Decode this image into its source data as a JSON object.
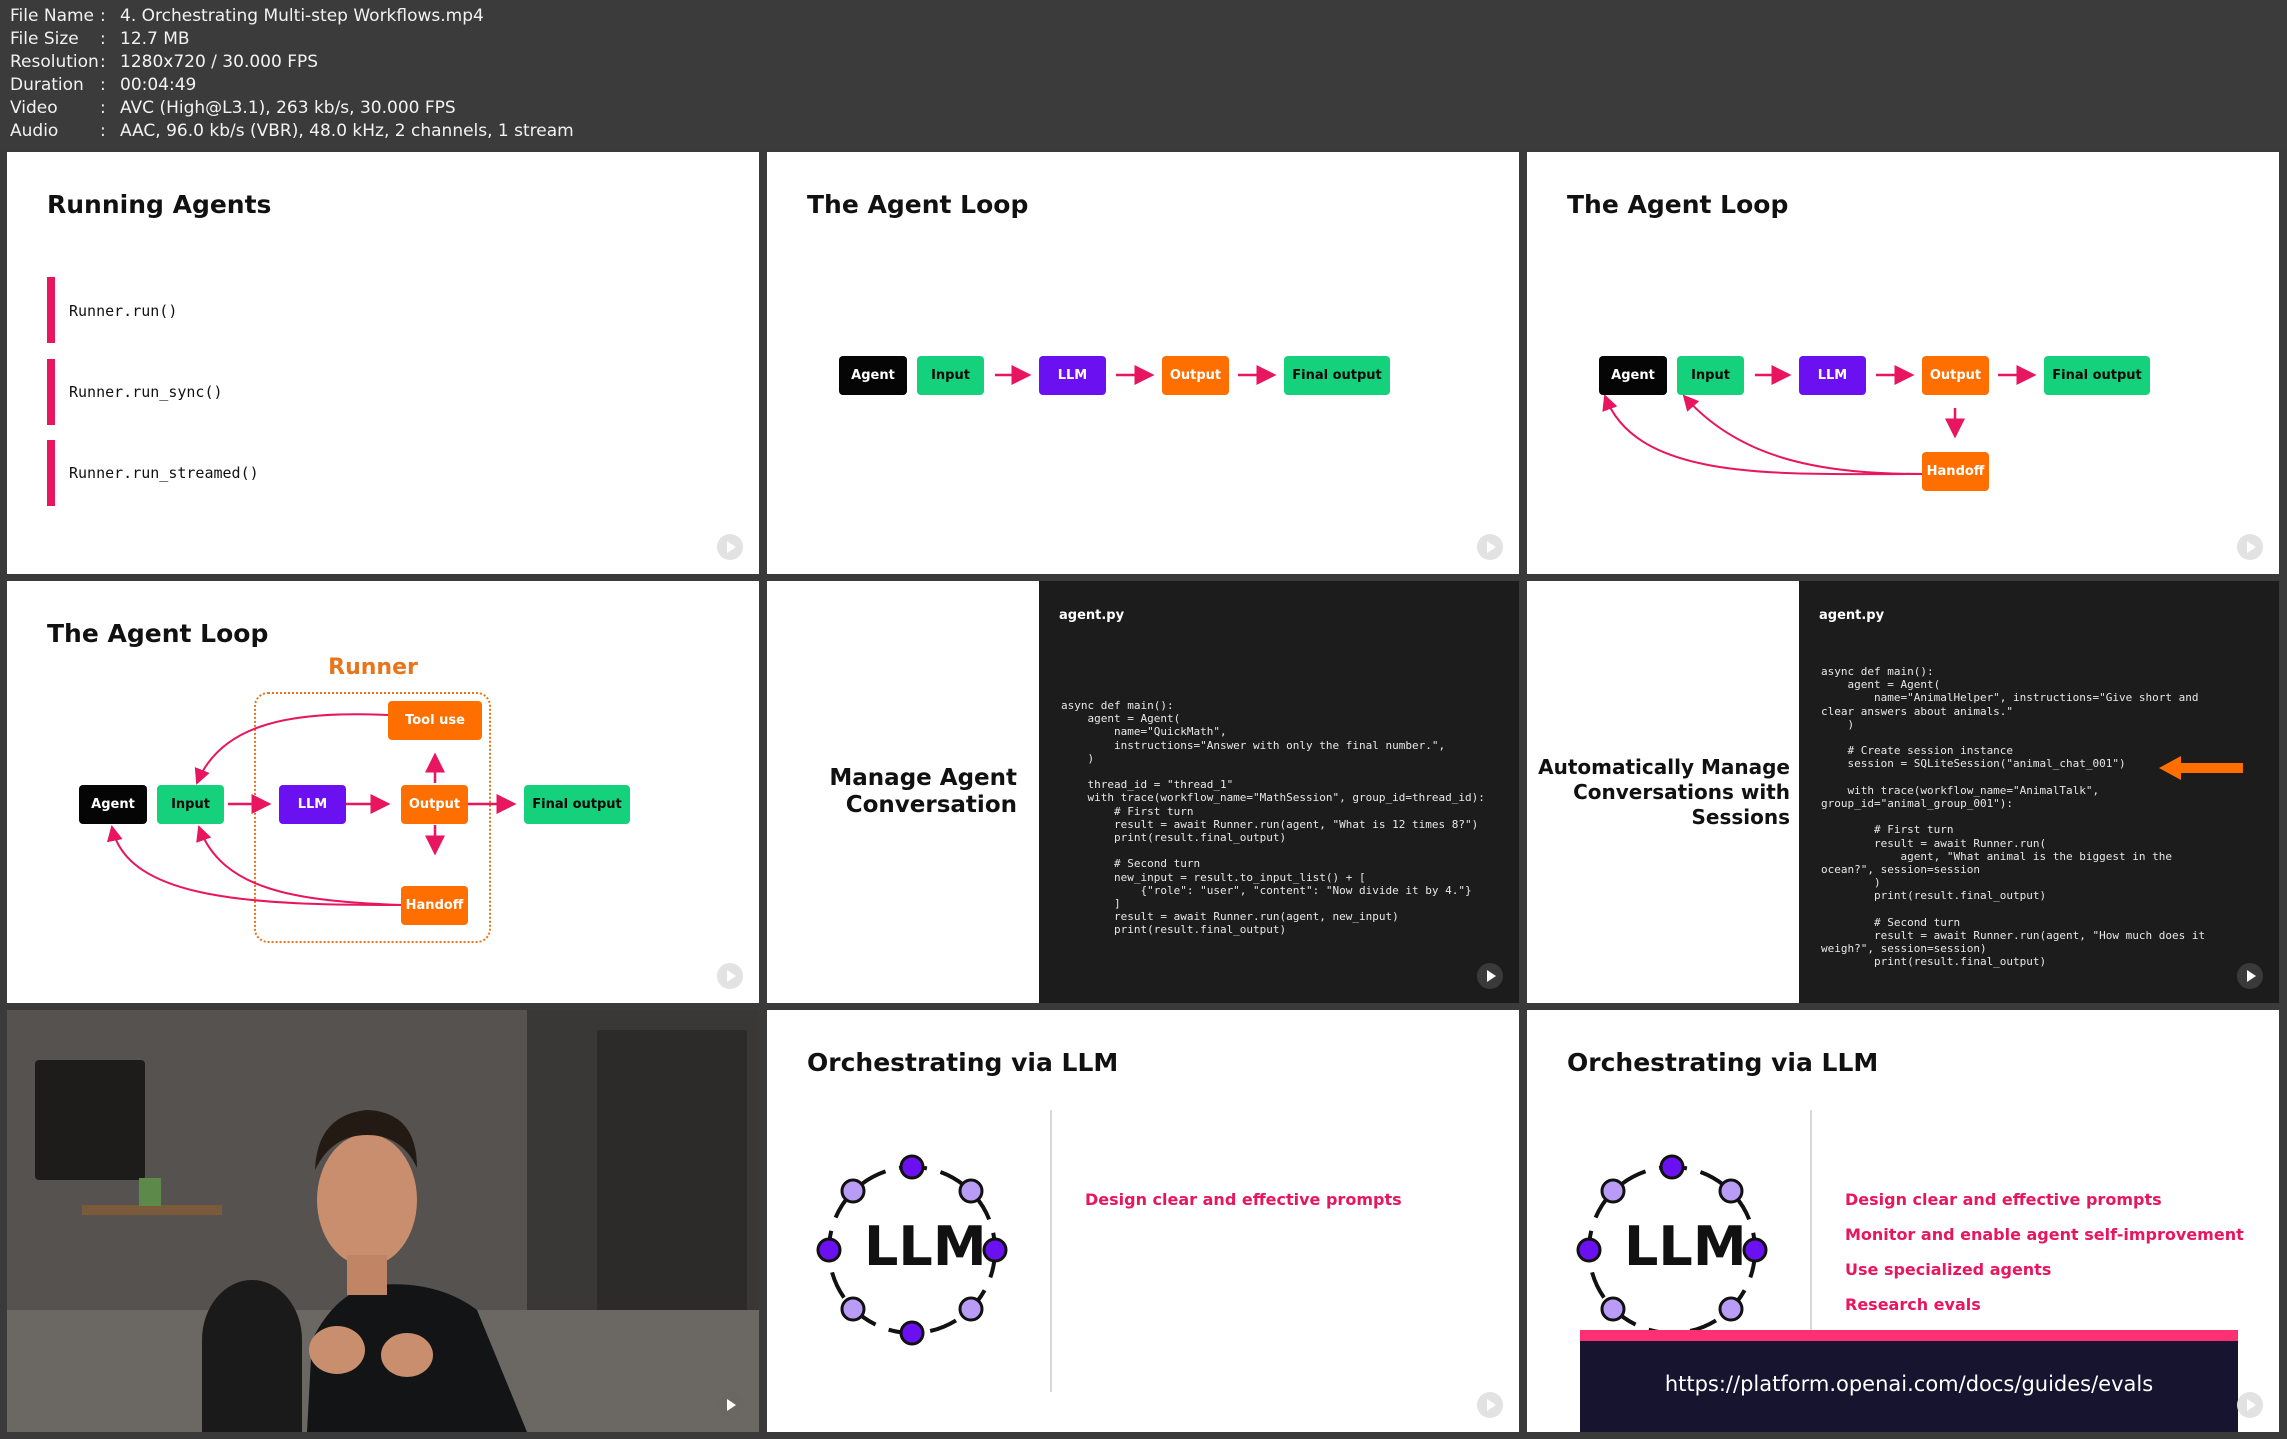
{
  "file_info": [
    {
      "key": "File Name",
      "value": "4. Orchestrating Multi-step Workflows.mp4"
    },
    {
      "key": "File Size",
      "value": "12.7 MB"
    },
    {
      "key": "Resolution",
      "value": "1280x720 / 30.000 FPS"
    },
    {
      "key": "Duration",
      "value": "00:04:49"
    },
    {
      "key": "Video",
      "value": "AVC (High@L3.1), 263 kb/s, 30.000 FPS"
    },
    {
      "key": "Audio",
      "value": "AAC, 96.0 kb/s (VBR), 48.0 kHz, 2 channels, 1 stream"
    }
  ],
  "slide1": {
    "title": "Running Agents",
    "items": [
      "Runner.run()",
      "Runner.run_sync()",
      "Runner.run_streamed()"
    ]
  },
  "labels": {
    "agent": "Agent",
    "input": "Input",
    "llm": "LLM",
    "output": "Output",
    "final_output": "Final output",
    "handoff": "Handoff",
    "tool_use": "Tool use",
    "runner": "Runner"
  },
  "slide2": {
    "title": "The Agent Loop"
  },
  "slide3": {
    "title": "The Agent Loop"
  },
  "slide4": {
    "title": "The Agent Loop"
  },
  "slide5": {
    "heading": "Manage Agent\nConversation",
    "filename": "agent.py",
    "code": "async def main():\n    agent = Agent(\n        name=\"QuickMath\",\n        instructions=\"Answer with only the final number.\",\n    )\n\n    thread_id = \"thread_1\"\n    with trace(workflow_name=\"MathSession\", group_id=thread_id):\n        # First turn\n        result = await Runner.run(agent, \"What is 12 times 8?\")\n        print(result.final_output)\n\n        # Second turn\n        new_input = result.to_input_list() + [\n            {\"role\": \"user\", \"content\": \"Now divide it by 4.\"}\n        ]\n        result = await Runner.run(agent, new_input)\n        print(result.final_output)"
  },
  "slide6": {
    "heading": "Automatically Manage\nConversations with\nSessions",
    "filename": "agent.py",
    "code": "async def main():\n    agent = Agent(\n        name=\"AnimalHelper\", instructions=\"Give short and\nclear answers about animals.\"\n    )\n\n    # Create session instance\n    session = SQLiteSession(\"animal_chat_001\")\n\n    with trace(workflow_name=\"AnimalTalk\",\ngroup_id=\"animal_group_001\"):\n\n        # First turn\n        result = await Runner.run(\n            agent, \"What animal is the biggest in the\nocean?\", session=session\n        )\n        print(result.final_output)\n\n        # Second turn\n        result = await Runner.run(agent, \"How much does it\nweigh?\", session=session)\n        print(result.final_output)"
  },
  "slide8": {
    "title": "Orchestrating via LLM",
    "logo_text": "LLM",
    "points": [
      "Design clear and effective prompts"
    ]
  },
  "slide9": {
    "title": "Orchestrating via LLM",
    "logo_text": "LLM",
    "points": [
      "Design clear and effective prompts",
      "Monitor and enable agent self-improvement",
      "Use specialized agents",
      "Research evals"
    ],
    "url": "https://platform.openai.com/docs/guides/evals"
  },
  "colors": {
    "accent_pink": "#e8155f",
    "agent_black": "#050505",
    "input_green": "#15d17c",
    "llm_purple": "#6b10f0",
    "output_orange": "#ff6f00",
    "runner_orange": "#e8751a"
  }
}
